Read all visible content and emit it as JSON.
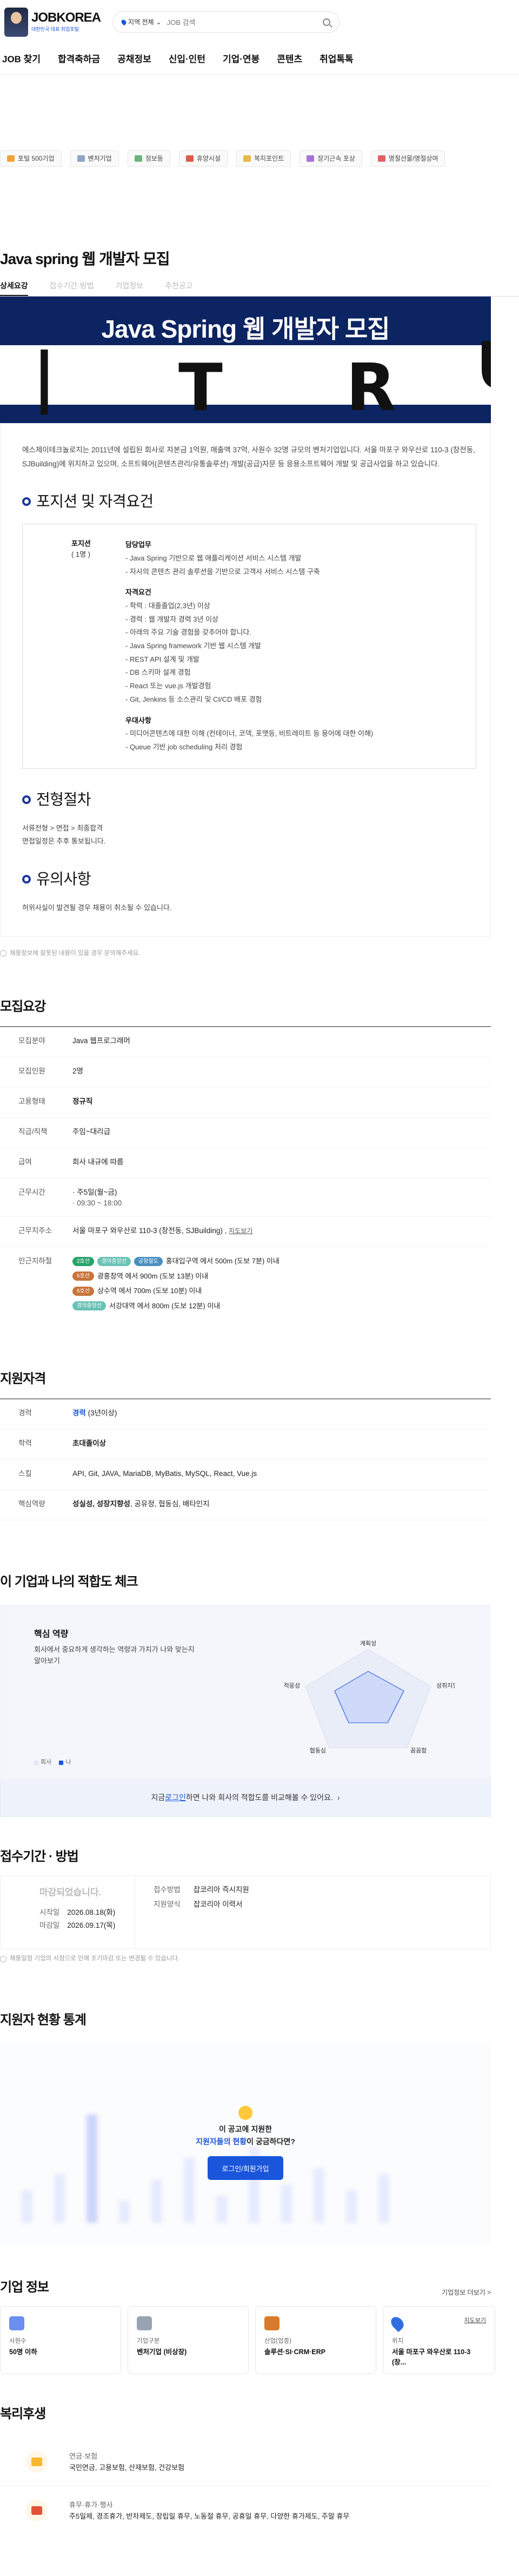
{
  "header": {
    "logo_text": "JOBKOREA",
    "logo_sub": "대한민국 대표 취업포털",
    "location_label": "지역 전체",
    "search_placeholder": "JOB 검색"
  },
  "gnb": [
    "JOB 찾기",
    "합격축하금",
    "공채정보",
    "신입·인턴",
    "기업·연봉",
    "콘텐츠",
    "취업톡톡"
  ],
  "chips": [
    {
      "label": "포털 500기업",
      "color": "#f0a23a"
    },
    {
      "label": "벤처기업",
      "color": "#8fa4c8"
    },
    {
      "label": "정보등",
      "color": "#6fb37a"
    },
    {
      "label": "휴양시설",
      "color": "#e05a4a"
    },
    {
      "label": "복지포인트",
      "color": "#e7b84a"
    },
    {
      "label": "장기근속 포상",
      "color": "#a874d8"
    },
    {
      "label": "명절선물/명절상여",
      "color": "#e56161"
    }
  ],
  "job": {
    "title": "Java spring 웹 개발자 모집",
    "tabs": [
      "상세요강",
      "접수기간·방법",
      "기업정보",
      "추천공고"
    ]
  },
  "hero": {
    "title": "Java Spring 웹 개발자 모집"
  },
  "detail": {
    "intro": "에스제이테크놀로지는 2011년에 설립된 회사로 자본금 1억원, 매출액 37억, 사원수 32명 규모의 벤처기업입니다. 서울 마포구 와우산로 110-3 (창전동, SJBuilding)에 위치하고 있으며, 소프트웨어(콘텐츠관리/유통솔루션) 개발(공급)자문 등 응용소프트웨어 개발 및 공급사업을 하고 있습니다.",
    "position_heading": "포지션 및 자격요건",
    "position_name": "포지션",
    "position_count": "( 1명 )",
    "duty_title": "담당업무",
    "duties": [
      "- Java Spring 기반으로 웹 애플리케이션 서비스 시스템 개발",
      "- 자사의 콘텐츠 관리 솔루션을 기반으로 고객사 서비스 시스템 구축"
    ],
    "req_title": "자격요건",
    "reqs": [
      "- 학력 : 대졸졸업(2,3년) 이상",
      "- 경력 : 웹 개발자 경력 3년 이상",
      "- 아래의 주요 기술 경험을 갖추어야 합니다.",
      "- Java Spring framework 기반 웹 시스템 개발",
      "- REST API 설계 및 개발",
      "- DB 스키마 설계 경험",
      "- React 또는 vue.js 개발경험",
      "- Git, Jenkins 등 소스관리 및 CI/CD 배포 경험"
    ],
    "pref_title": "우대사항",
    "prefs": [
      "- 미디어콘텐츠에 대한 이해 (컨테이너, 코덱, 포맷등, 비트레이트 등 용어에 대한 이해)",
      "- Queue 기반 job scheduling 처리 경험"
    ],
    "process_heading": "전형절차",
    "process": [
      "서류전형 > 면접 > 최종합격",
      "면접일정은 추후 통보됩니다."
    ],
    "notice_heading": "유의사항",
    "notice": [
      "허위사실이 발견될 경우 채용이 취소될 수 있습니다."
    ],
    "report_text": "채용정보에 잘못된 내용이 있을 경우 문의해주세요."
  },
  "summary": {
    "heading": "모집요강",
    "rows": [
      {
        "k": "모집분야",
        "v": "Java 웹프로그래머"
      },
      {
        "k": "모집인원",
        "v": "2명"
      },
      {
        "k": "고용형태",
        "v": "정규직"
      },
      {
        "k": "직급/직책",
        "v": "주임~대리급"
      },
      {
        "k": "급여",
        "v": "회사 내규에 따름"
      },
      {
        "k": "근무시간",
        "v": "· 주5일(월~금)",
        "v2": "· 09:30 ~ 18:00"
      },
      {
        "k": "근무지주소",
        "v": "서울 마포구 와우산로 110-3 (창전동, SJBuilding) ,",
        "link": "지도보기"
      }
    ],
    "subway_label": "인근지하철",
    "subway": [
      {
        "tags": [
          {
            "t": "2호선",
            "c": "#2aa36b"
          },
          {
            "t": "경의중앙선",
            "c": "#6ac2b6"
          },
          {
            "t": "공항철도",
            "c": "#4a8fc1"
          }
        ],
        "text": "홍대입구역 에서 500m (도보 7분) 이내"
      },
      {
        "tags": [
          {
            "t": "6호선",
            "c": "#c8743a"
          }
        ],
        "text": "광흥창역 에서 900m (도보 13분) 이내"
      },
      {
        "tags": [
          {
            "t": "6호선",
            "c": "#c8743a"
          }
        ],
        "text": "상수역 에서 700m (도보 10분) 이내"
      },
      {
        "tags": [
          {
            "t": "경의중앙선",
            "c": "#6ac2b6"
          }
        ],
        "text": "서강대역 에서 800m (도보 12분) 이내"
      }
    ]
  },
  "qual": {
    "heading": "지원자격",
    "rows": [
      {
        "k": "경력",
        "v": "경력",
        "v2": " (3년이상)"
      },
      {
        "k": "학력",
        "v": "초대졸이상"
      },
      {
        "k": "스킬",
        "v": "API, Git, JAVA, MariaDB, MyBatis, MySQL, React, Vue.js"
      },
      {
        "k": "핵심역량",
        "v": "성실성, 성장지향성",
        "v2": ", 공유정, 협동심, 배타인지"
      }
    ]
  },
  "fit": {
    "heading": "이 기업과 나의 적합도 체크",
    "title": "핵심 역량",
    "desc": "회사에서 중요하게 생각하는 역량과 가치가 나와 맞는지 알아보기",
    "axes": [
      "계획성",
      "성취지향성",
      "꼼꼼함",
      "협동심",
      "적응성"
    ],
    "legend_company": "회사",
    "legend_me": "나",
    "company_color": "#e0e6f7",
    "me_color": "#1a56db",
    "bottom_pre": "지금 ",
    "bottom_link": "로그인",
    "bottom_post": " 하면 나와 회사의 적합도를 비교해볼 수 있어요.",
    "chevron": "chevron-right-icon"
  },
  "period": {
    "heading": "접수기간 · 방법",
    "closed": "마감되었습니다.",
    "start_label": "시작일",
    "start": "2026.08.18(화)",
    "end_label": "마감일",
    "end": "2026.09.17(목)",
    "method_label": "접수방법",
    "method": "잡코리아 즉시지원",
    "form_label": "지원양식",
    "form": "잡코리아 이력서",
    "notice": "채용일정 기업의 사정으로 인해 조기마감 또는 변경될 수 있습니다."
  },
  "stat": {
    "heading": "지원자 현황 통계",
    "line1": "이 공고에 지원한",
    "line2_pre": "",
    "line2_b": "지원자들의 현황",
    "line2_post": "이 궁금하다면?",
    "button": "로그인/회원가입"
  },
  "company": {
    "heading": "기업 정보",
    "more": "기업정보 더보기 >",
    "cards": [
      {
        "label": "사원수",
        "value": "50명 이하",
        "color": "#6b8ef0"
      },
      {
        "label": "기업구분",
        "value": "벤처기업 (비상장)",
        "color": "#9aa3b2"
      },
      {
        "label": "산업(업종)",
        "value": "솔루션·SI·CRM·ERP",
        "color": "#d97a2b"
      },
      {
        "label": "위치",
        "value": "서울 마포구 와우산로 110-3 (창...",
        "color": "#2f6fe0",
        "map": "지도보기"
      }
    ]
  },
  "welfare": {
    "heading": "복리후생",
    "items": [
      {
        "title": "연금·보험",
        "desc": "국민연금, 고용보험, 산재보험, 건강보험",
        "color": "#f7b731"
      },
      {
        "title": "휴무·휴가·행사",
        "desc": "주5일제, 경조휴가, 반차제도, 창립일 휴무, 노동절 휴무, 공휴일 휴무, 다양한 휴가제도, 주말 휴무",
        "color": "#e55039"
      }
    ]
  }
}
